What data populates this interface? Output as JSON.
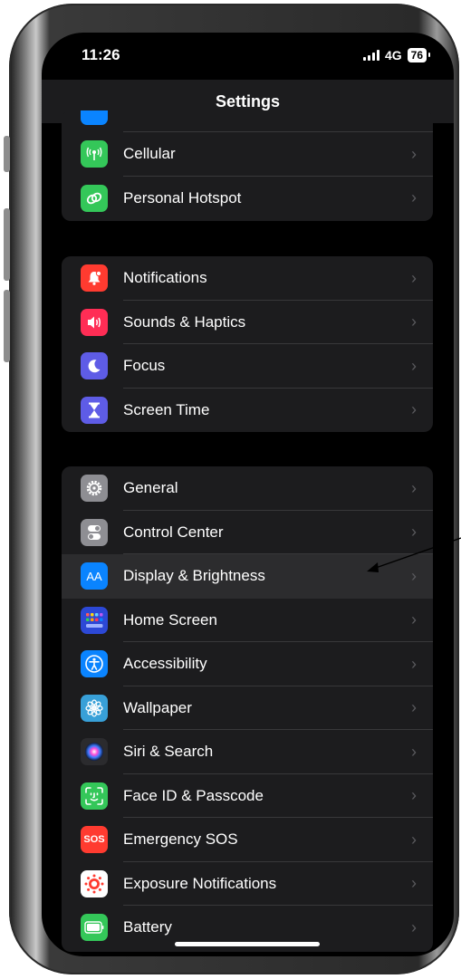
{
  "status": {
    "time": "11:26",
    "network": "4G",
    "battery": "76"
  },
  "nav": {
    "title": "Settings"
  },
  "groups": [
    {
      "rows": [
        {
          "label": "Cellular",
          "icon": "cellular-icon",
          "color": "#34c759"
        },
        {
          "label": "Personal Hotspot",
          "icon": "hotspot-icon",
          "color": "#34c759"
        }
      ]
    },
    {
      "rows": [
        {
          "label": "Notifications",
          "icon": "bell-icon",
          "color": "#ff3b30"
        },
        {
          "label": "Sounds & Haptics",
          "icon": "speaker-icon",
          "color": "#ff2d55"
        },
        {
          "label": "Focus",
          "icon": "moon-icon",
          "color": "#5e5ce6"
        },
        {
          "label": "Screen Time",
          "icon": "hourglass-icon",
          "color": "#5e5ce6"
        }
      ]
    },
    {
      "rows": [
        {
          "label": "General",
          "icon": "gear-icon",
          "color": "#8e8e93"
        },
        {
          "label": "Control Center",
          "icon": "toggles-icon",
          "color": "#8e8e93"
        },
        {
          "label": "Display & Brightness",
          "icon": "text-size-icon",
          "color": "#0a84ff"
        },
        {
          "label": "Home Screen",
          "icon": "app-grid-icon",
          "color": "#2c48d6"
        },
        {
          "label": "Accessibility",
          "icon": "accessibility-icon",
          "color": "#0a84ff"
        },
        {
          "label": "Wallpaper",
          "icon": "flower-icon",
          "color": "#38a0d8"
        },
        {
          "label": "Siri & Search",
          "icon": "siri-icon",
          "color": "#2b2b2e"
        },
        {
          "label": "Face ID & Passcode",
          "icon": "face-id-icon",
          "color": "#34c759"
        },
        {
          "label": "Emergency SOS",
          "icon": "sos-icon",
          "color": "#ff3b30"
        },
        {
          "label": "Exposure Notifications",
          "icon": "exposure-icon",
          "color": "#ffffff"
        },
        {
          "label": "Battery",
          "icon": "battery-icon",
          "color": "#34c759"
        }
      ]
    }
  ],
  "icon_text": {
    "aa": "AA",
    "sos": "SOS"
  },
  "accent": {
    "selected_row": "#2c2c2e",
    "annotation_arrow": "#000000"
  }
}
